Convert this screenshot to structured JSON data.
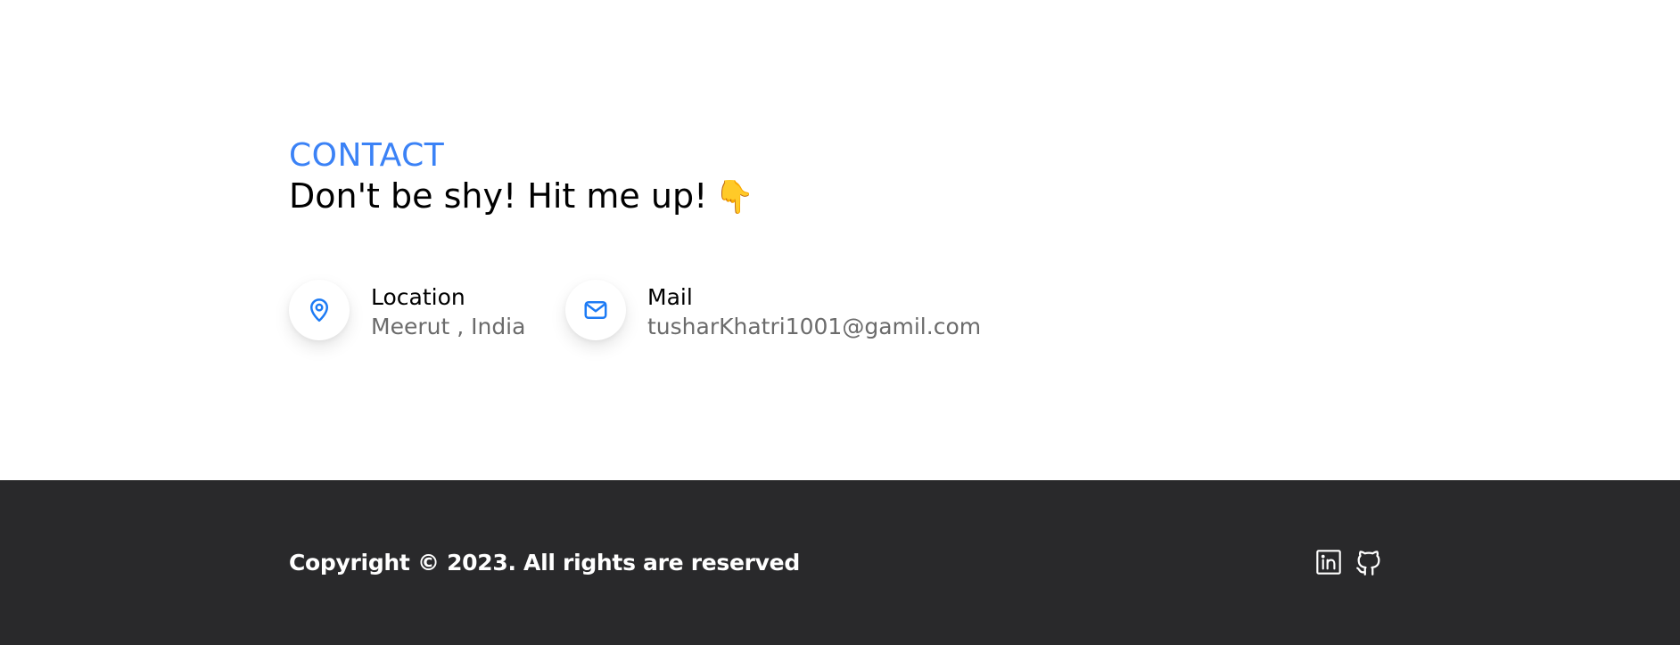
{
  "contact": {
    "eyebrow": "CONTACT",
    "heading": "Don't be shy! Hit me up!",
    "heading_emoji": "👇",
    "items": [
      {
        "label": "Location",
        "value": "Meerut , India",
        "icon": "map-pin-icon"
      },
      {
        "label": "Mail",
        "value": "tusharKhatri1001@gamil.com",
        "icon": "mail-icon"
      }
    ]
  },
  "footer": {
    "copyright": "Copyright © 2023. All rights are reserved",
    "social": [
      {
        "name": "LinkedIn",
        "icon": "linkedin-icon"
      },
      {
        "name": "GitHub",
        "icon": "github-icon"
      }
    ]
  },
  "colors": {
    "accent": "#3b82f6",
    "icon_blue": "#1d7bf5",
    "footer_bg": "#29292b",
    "muted_text": "#6b6b6b"
  }
}
